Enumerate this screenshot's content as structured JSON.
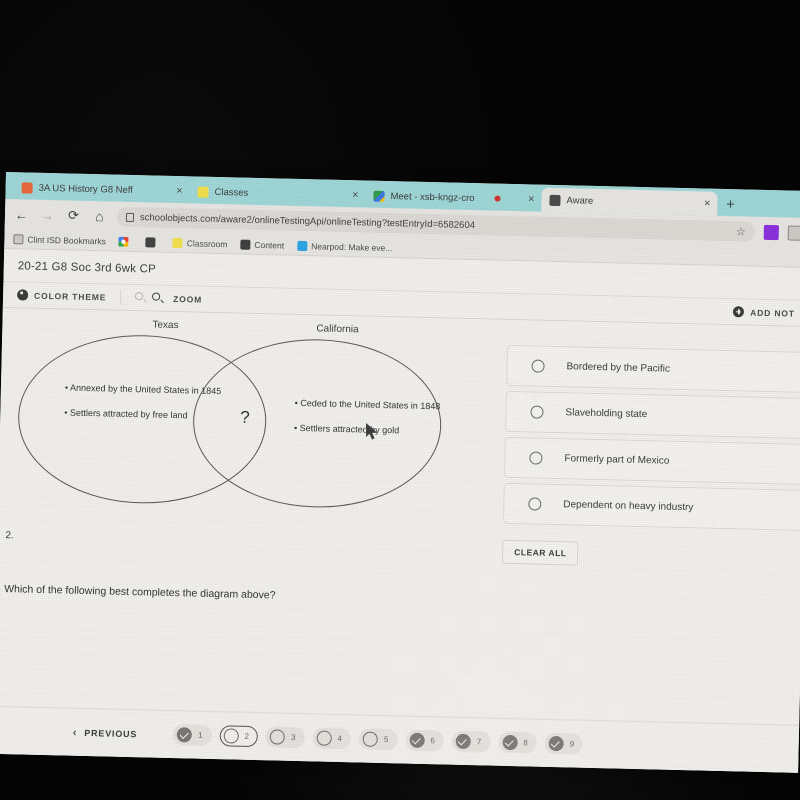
{
  "browser": {
    "tabs": [
      {
        "title": "3A US History G8 Neff",
        "favicon": "orange-square-icon",
        "active": false,
        "close": "×"
      },
      {
        "title": "Classes",
        "favicon": "yellow-square-icon",
        "active": false,
        "close": "×"
      },
      {
        "title": "Meet - xsb-kngz-cro",
        "favicon": "google-meet-icon",
        "active": false,
        "close": "×",
        "recording": true
      },
      {
        "title": "Aware",
        "favicon": "globe-icon",
        "active": true,
        "close": "×"
      }
    ],
    "new_tab_label": "+",
    "nav": {
      "back": "←",
      "forward": "→",
      "reload": "⟳",
      "home": "⌂",
      "url": "schoolobjects.com/aware2/onlineTestingApi/onlineTesting?testEntryId=6582604",
      "bookmark_star": "☆"
    },
    "bookmarks": [
      {
        "label": "Clint ISD Bookmarks",
        "icon": "folder-icon"
      },
      {
        "label": "",
        "icon": "google-icon"
      },
      {
        "label": "",
        "icon": "globe-icon"
      },
      {
        "label": "Classroom",
        "icon": "classroom-icon"
      },
      {
        "label": "Content",
        "icon": "content-icon"
      },
      {
        "label": "Nearpod: Make eve...",
        "icon": "nearpod-icon"
      }
    ]
  },
  "app": {
    "title": "20-21 G8 Soc 3rd 6wk CP",
    "toolbar": {
      "color_theme": "COLOR THEME",
      "zoom": "ZOOM",
      "add_note": "ADD NOT"
    }
  },
  "question": {
    "number": "2.",
    "prompt": "Which of the following best completes the diagram above?",
    "diagram": {
      "left_label": "Texas",
      "right_label": "California",
      "left_bullets": [
        "• Annexed by the United States in 1845",
        "• Settlers attracted by free land"
      ],
      "right_bullets": [
        "• Ceded to the United States in 1848",
        "• Settlers attracted by gold"
      ],
      "intersection": "?"
    },
    "choices": [
      {
        "label": "Bordered by the Pacific",
        "selected": false
      },
      {
        "label": "Slaveholding state",
        "selected": false
      },
      {
        "label": "Formerly part of Mexico",
        "selected": false
      },
      {
        "label": "Dependent on heavy industry",
        "selected": false
      }
    ],
    "clear_all": "CLEAR ALL"
  },
  "footer": {
    "previous": "PREVIOUS",
    "pager": [
      {
        "number": "1",
        "state": "answered"
      },
      {
        "number": "2",
        "state": "current"
      },
      {
        "number": "3",
        "state": "unanswered"
      },
      {
        "number": "4",
        "state": "unanswered"
      },
      {
        "number": "5",
        "state": "unanswered"
      },
      {
        "number": "6",
        "state": "answered"
      },
      {
        "number": "7",
        "state": "answered"
      },
      {
        "number": "8",
        "state": "answered"
      },
      {
        "number": "9",
        "state": "answered"
      }
    ]
  },
  "colors": {
    "tabstrip": "#9ed7d8",
    "chrome": "#e9e7e3",
    "page": "#f3f1ed",
    "text": "#3a3a3a",
    "recording_dot": "#d6322b"
  }
}
